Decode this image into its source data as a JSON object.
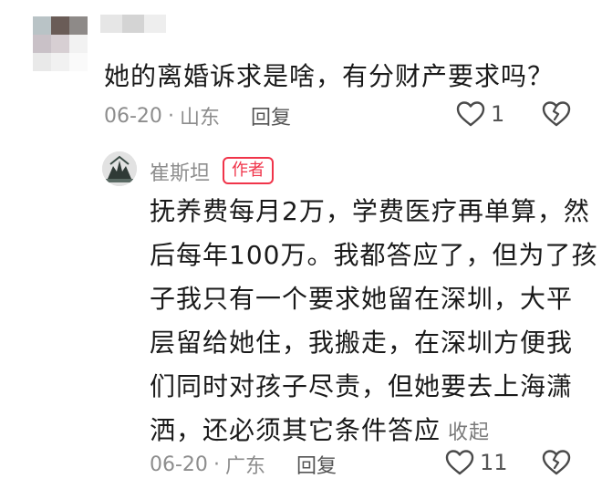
{
  "comment1": {
    "text": "她的离婚诉求是啥，有分财产要求吗？",
    "date": "06-20",
    "location": "山东",
    "reply_label": "回复",
    "like_count": "1",
    "icons": {
      "like": "heart-icon",
      "dislike": "broken-heart-icon"
    }
  },
  "comment2": {
    "username": "崔斯坦",
    "badge": "作者",
    "lines": [
      "抚养费每月2万，学费医疗再单算，然",
      "后每年100万。我都答应了，但为了孩",
      "子我只有一个要求她留在深圳，大平",
      "层留给她住，我搬走，在深圳方便我",
      "们同时对孩子尽责，但她要去上海潇",
      "洒，还必须其它条件答应"
    ],
    "collapse_label": "收起",
    "date": "06-20",
    "location": "广东",
    "reply_label": "回复",
    "like_count": "11",
    "icons": {
      "like": "heart-icon",
      "dislike": "broken-heart-icon"
    }
  },
  "colors": {
    "accent_badge": "#f0344a",
    "meta_text": "#8d8d8d"
  }
}
